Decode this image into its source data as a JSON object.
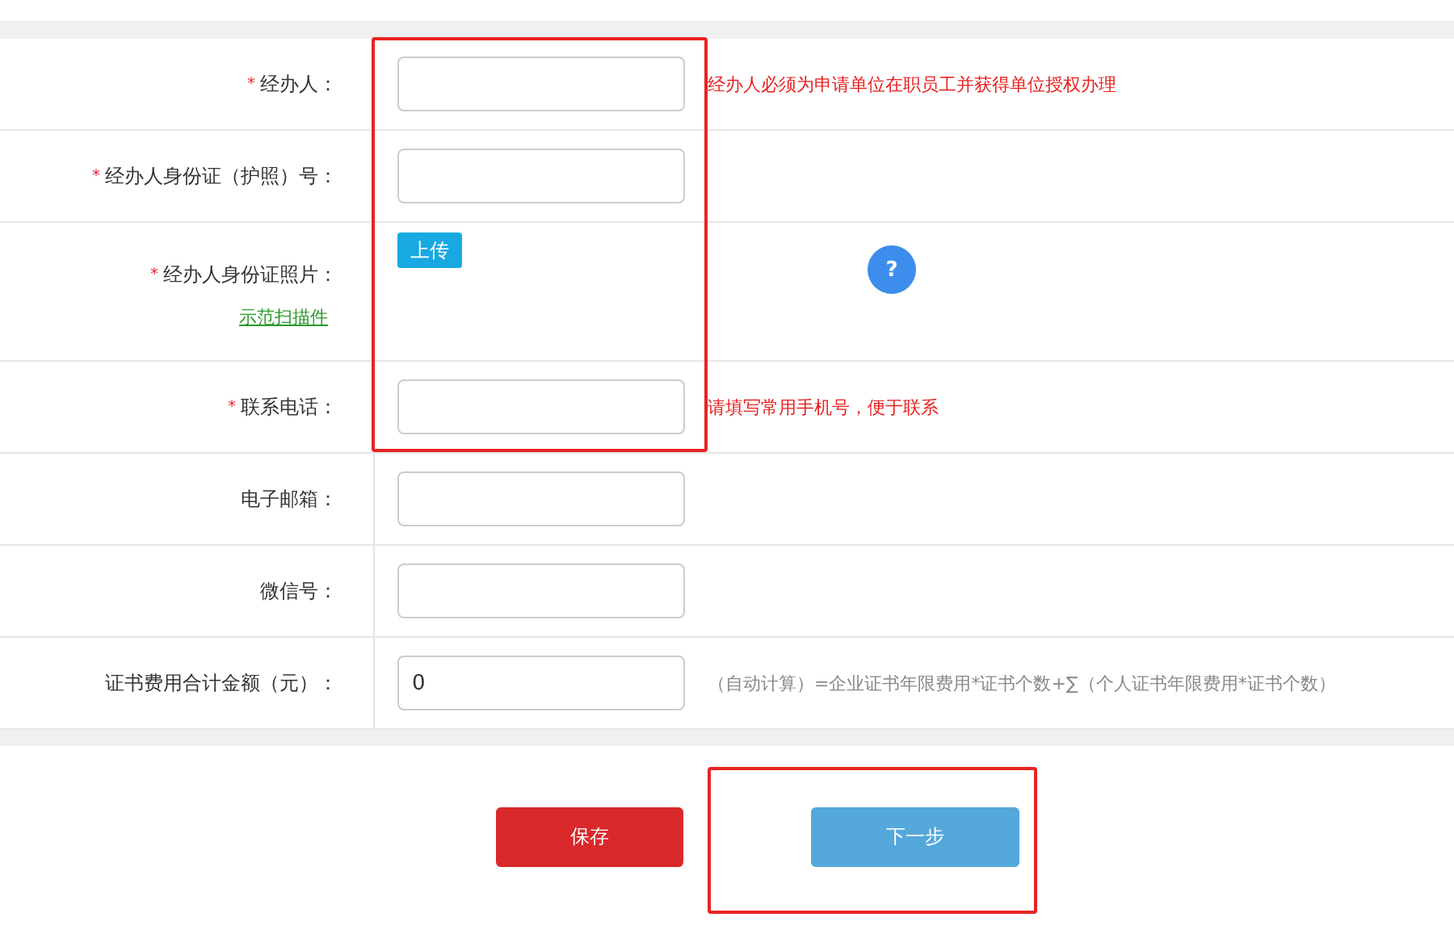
{
  "form": {
    "rows": [
      {
        "kind": "input",
        "label": "经办人：",
        "required_mark": "*",
        "value": "",
        "hint": {
          "text": "经办人必须为申请单位在职员工并获得单位授权办理",
          "color": "#e8201f"
        }
      },
      {
        "kind": "input",
        "label": "经办人身份证（护照）号：",
        "required_mark": "*",
        "value": ""
      },
      {
        "kind": "upload",
        "label": "经办人身份证照片：",
        "required_mark": "*",
        "link": "示范扫描件",
        "button": "上传",
        "help": "?"
      },
      {
        "kind": "input",
        "label": "联系电话：",
        "required_mark": "*",
        "value": "",
        "hint": {
          "text": "请填写常用手机号，便于联系",
          "color": "#e8201f"
        }
      },
      {
        "kind": "input",
        "label": "电子邮箱：",
        "value": ""
      },
      {
        "kind": "input",
        "label": "微信号：",
        "value": ""
      },
      {
        "kind": "input",
        "label": "证书费用合计金额（元）：",
        "value": "0",
        "hint": {
          "text": "（自动计算）=企业证书年限费用*证书个数+∑（个人证书年限费用*证书个数）",
          "color": "#888888"
        }
      }
    ]
  },
  "actions": [
    {
      "kind": "save",
      "label": "保存"
    },
    {
      "kind": "next",
      "label": "下一步"
    }
  ]
}
